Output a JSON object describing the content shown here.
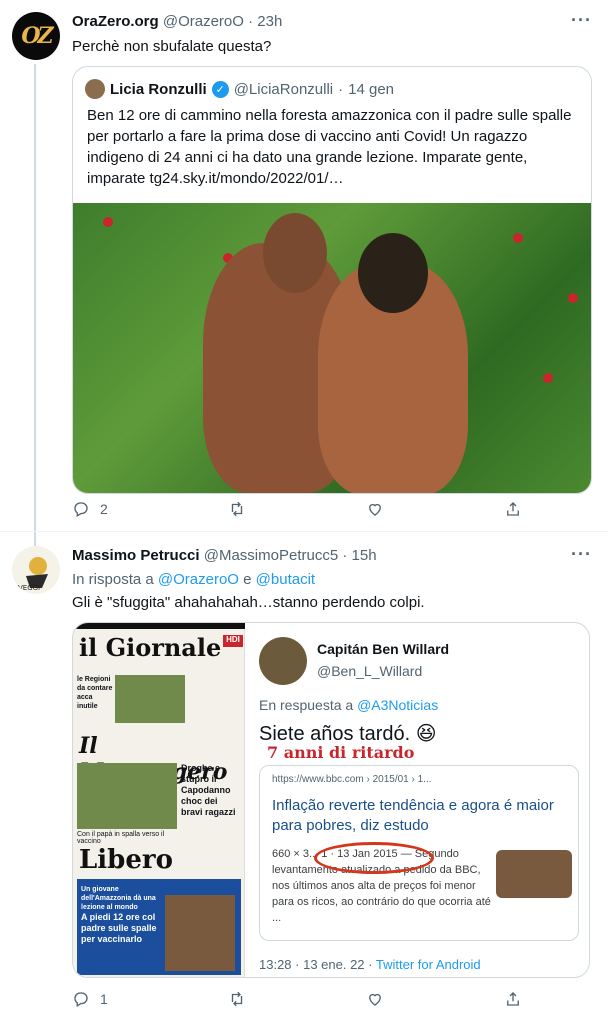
{
  "tweet1": {
    "name": "OraZero.org",
    "handle": "@OrazeroO",
    "time": "23h",
    "text": "Perchè non sbufalate questa?",
    "quote": {
      "name": "Licia Ronzulli",
      "handle": "@LiciaRonzulli",
      "time": "14 gen",
      "text": "Ben 12 ore di cammino nella foresta amazzonica con il padre sulle spalle per portarlo a fare la prima dose di vaccino anti Covid! Un ragazzo indigeno di 24 anni ci ha dato una grande lezione. Imparate gente, imparate tg24.sky.it/mondo/2022/01/…"
    },
    "replies": "2"
  },
  "tweet2": {
    "name": "Massimo Petrucci",
    "handle": "@MassimoPetrucc5",
    "time": "15h",
    "reply_prefix": "In risposta a",
    "reply_to1": "@OrazeroO",
    "reply_and": "e",
    "reply_to2": "@butacit",
    "text": "Gli è \"sfuggita\" ahahahahah…stanno perdendo colpi.",
    "replies": "1",
    "image": {
      "paper1": "il Giornale",
      "paper1_badge": "HDI",
      "paper1_head": "le Regioni da contare acca inutile",
      "paper2": "Il Messaggero",
      "paper2_head": "Droghe e stupro il Capodanno choc dei bravi ragazzi",
      "paper2_caption": "Con il papà in spalla verso il vaccino",
      "paper3": "Libero",
      "paper3_top": "Un giovane dell'Amazzonia dà una lezione al mondo",
      "paper3_head": "A piedi 12 ore col padre sulle spalle per vaccinarlo",
      "tw_name": "Capitán Ben Willard",
      "tw_handle": "@Ben_L_Willard",
      "tw_reply": "En respuesta a",
      "tw_reply_to": "@A3Noticias",
      "tw_text": "Siete años tardó. 😆",
      "overlay": "7 anni di ritardo",
      "card_url": "https://www.bbc.com › 2015/01 › 1...",
      "card_title": "Inflação reverte tendência e agora é maior para pobres, diz estudo",
      "card_meta": "660 × 3... 1 · 13 Jan 2015 — Segundo levantamento atualizado a pedido da BBC, nos últimos anos alta de preços foi menor para os ricos, ao contrário do que ocorria até ...",
      "tw_time": "13:28 · 13 ene. 22 ·",
      "tw_source": "Twitter for Android"
    }
  },
  "colors": {
    "accent": "#1d9bf0",
    "text": "#0f1419",
    "muted": "#536471",
    "border": "#cfd9de"
  }
}
